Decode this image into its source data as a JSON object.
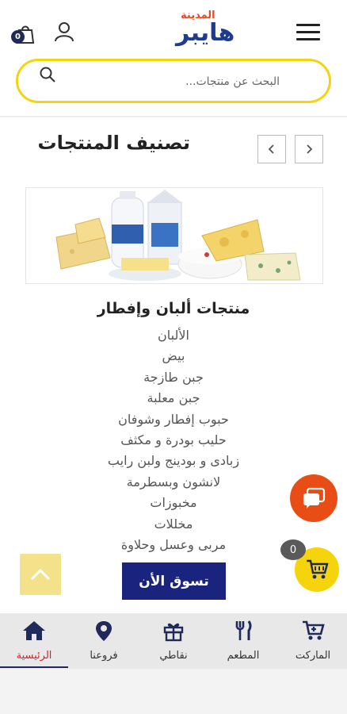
{
  "header": {
    "cart_count": "0",
    "logo_top": "المدينة",
    "logo_main": "هايبر"
  },
  "search": {
    "placeholder": "...البحث عن منتجات"
  },
  "section": {
    "title": "تصنيف المنتجات"
  },
  "category": {
    "title": "منتجات ألبان وإفطار",
    "subcategories": [
      "الألبان",
      "بيض",
      "جبن طازجة",
      "جبن معلبة",
      "حبوب إفطار وشوفان",
      "حليب بودرة و مكثف",
      "زبادى و بودينج ولبن رايب",
      "لانشون وبسطرمة",
      "مخبوزات",
      "مخللات",
      "مربى وعسل وحلاوة"
    ],
    "shop_button": "تسوق الأن"
  },
  "floating_cart": {
    "count": "0"
  },
  "bottom_nav": {
    "items": [
      {
        "label": "الماركت",
        "icon": "cart-icon"
      },
      {
        "label": "المطعم",
        "icon": "fork-knife-icon"
      },
      {
        "label": "نقاطي",
        "icon": "gift-icon"
      },
      {
        "label": "فروعنا",
        "icon": "map-pin-icon"
      },
      {
        "label": "الرئيسية",
        "icon": "home-icon",
        "active": true
      }
    ]
  },
  "colors": {
    "brand_blue": "#1f3b8f",
    "brand_orange": "#e84a1f",
    "accent_yellow": "#f2d40f",
    "shop_button": "#1a237e",
    "active_nav": "#d8202a"
  }
}
